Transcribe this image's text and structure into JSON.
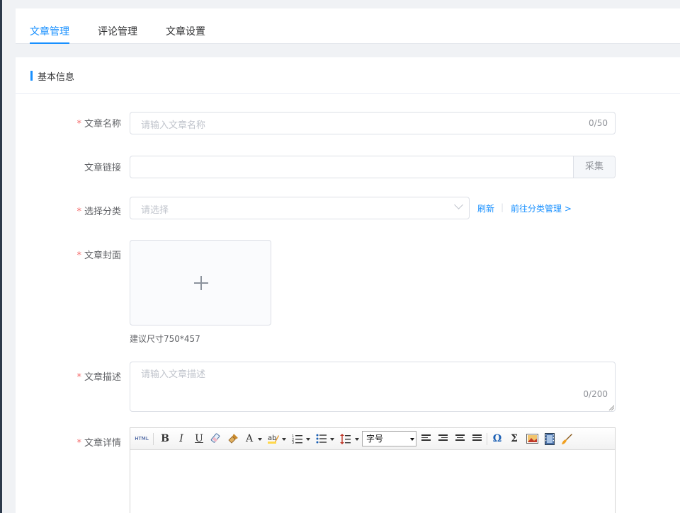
{
  "tabs": [
    {
      "label": "文章管理",
      "active": true
    },
    {
      "label": "评论管理",
      "active": false
    },
    {
      "label": "文章设置",
      "active": false
    }
  ],
  "section": {
    "title": "基本信息"
  },
  "form": {
    "required_mark": "*",
    "title": {
      "label": "文章名称",
      "placeholder": "请输入文章名称",
      "counter": "0/50"
    },
    "link": {
      "label": "文章链接",
      "button": "采集"
    },
    "category": {
      "label": "选择分类",
      "placeholder": "请选择",
      "refresh": "刷新",
      "separator": "|",
      "manage": "前往分类管理 >"
    },
    "cover": {
      "label": "文章封面",
      "hint": "建议尺寸750*457"
    },
    "description": {
      "label": "文章描述",
      "placeholder": "请输入文章描述",
      "counter": "0/200"
    },
    "detail": {
      "label": "文章详情"
    }
  },
  "editor": {
    "html_label": "HTML",
    "bold": "B",
    "italic": "I",
    "underline": "U",
    "fontcolor": "A",
    "fontsize_select": "字号"
  },
  "colors": {
    "accent": "#1890ff",
    "required": "#f56c6c"
  }
}
